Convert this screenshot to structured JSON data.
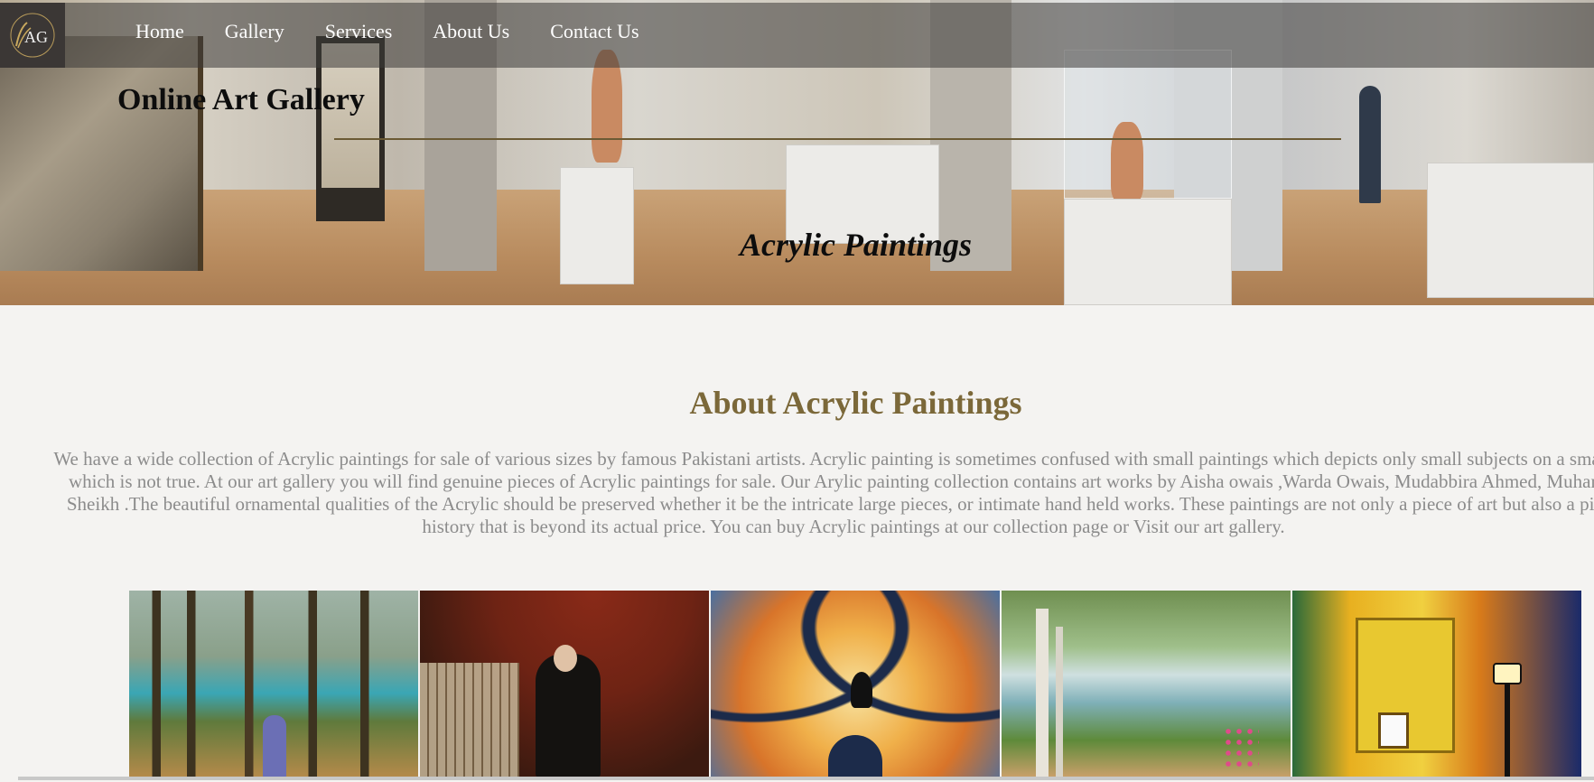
{
  "logo": {
    "text": "AG",
    "icon": "art-gallery-logo"
  },
  "nav": {
    "items": [
      {
        "label": "Home"
      },
      {
        "label": "Gallery"
      },
      {
        "label": "Services"
      },
      {
        "label": "About Us"
      },
      {
        "label": "Contact Us"
      }
    ]
  },
  "hero": {
    "site_title": "Online Art Gallery",
    "subtitle": "Acrylic Paintings"
  },
  "about": {
    "heading": "About Acrylic Paintings",
    "body": "We have a wide collection of Acrylic paintings for sale of various sizes by famous Pakistani artists. Acrylic painting is sometimes confused with small paintings which depicts only small subjects on a small scale which is not true. At our art gallery you will find genuine pieces of Acrylic paintings for sale. Our Arylic painting collection contains art works by Aisha owais ,Warda Owais, Mudabbira Ahmed, Muhammad Sheikh .The beautiful ornamental qualities of the Acrylic should be preserved whether it be the intricate large pieces, or intimate hand held works. These paintings are not only a piece of art but also a piece of history that is beyond its actual price. You can buy Acrylic paintings at our collection page or Visit our art gallery."
  },
  "gallery": {
    "paintings": [
      {
        "subject": "girl-in-forest-painting"
      },
      {
        "subject": "portrait-man-curtain-painting"
      },
      {
        "subject": "girl-on-swing-antlers-painting"
      },
      {
        "subject": "birch-lake-landscape-painting"
      },
      {
        "subject": "yellow-house-street-lamp-painting"
      }
    ]
  },
  "colors": {
    "heading_accent": "#7b6839",
    "body_text": "#8c8c8c",
    "page_background": "#f4f3f1",
    "nav_overlay": "rgba(60,58,56,0.55)"
  }
}
